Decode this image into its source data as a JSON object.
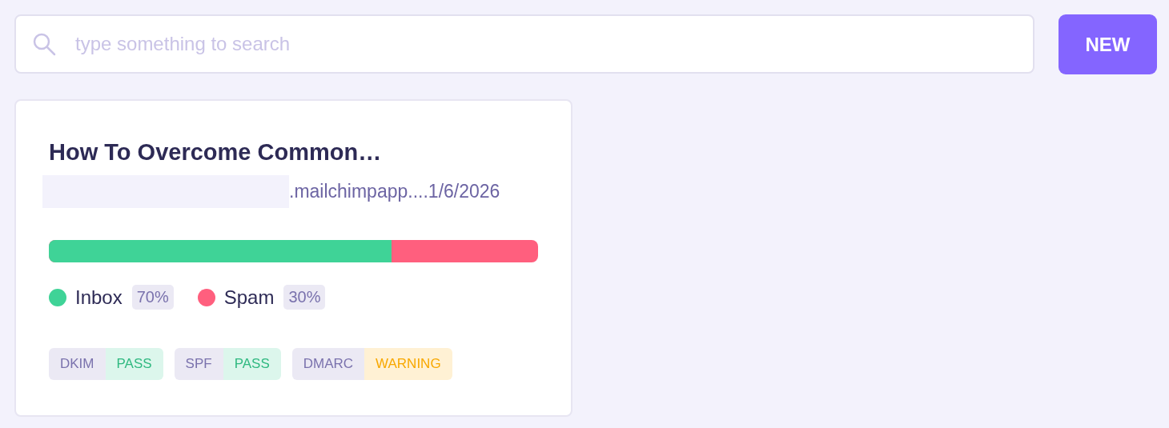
{
  "search": {
    "placeholder": "type something to search"
  },
  "new_button": "NEW",
  "cards": [
    {
      "title": "How To Overcome Common…",
      "sender": ".mailchimpapp....",
      "date": "1/6/2026",
      "placement": [
        {
          "label": "Inbox",
          "share": "70%",
          "level": 0.7,
          "color": "#3fd397"
        },
        {
          "label": "Spam",
          "share": "30%",
          "color": "#ff5f7e"
        }
      ],
      "checks": [
        {
          "name": "DKIM",
          "result": "PASS",
          "kind": "pass"
        },
        {
          "name": "SPF",
          "result": "PASS",
          "kind": "pass"
        },
        {
          "name": "DMARC",
          "result": "WARNING",
          "kind": "warning"
        }
      ]
    }
  ]
}
